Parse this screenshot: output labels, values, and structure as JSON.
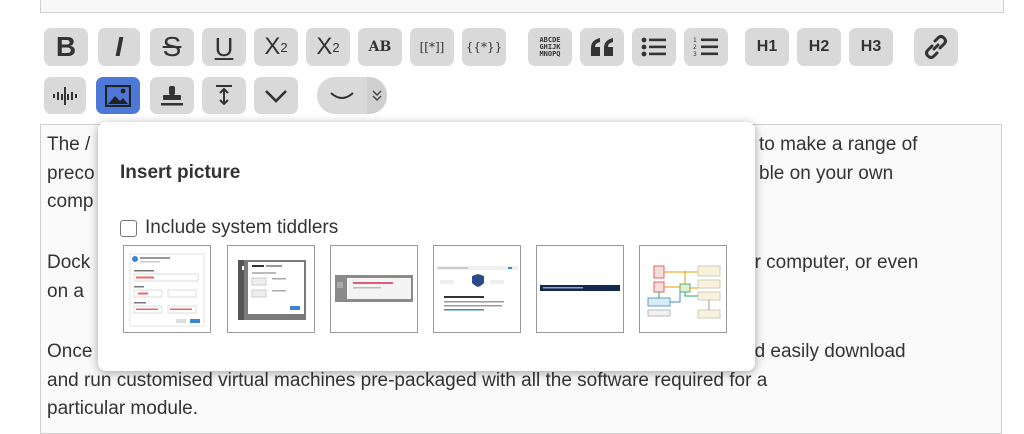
{
  "toolbar": {
    "row1": [
      {
        "name": "bold-button",
        "label": "B"
      },
      {
        "name": "italic-button",
        "label": "I"
      },
      {
        "name": "strikethrough-button",
        "label": "S"
      },
      {
        "name": "underline-button",
        "label": "U"
      },
      {
        "name": "superscript-button",
        "label": "X",
        "sup": "2"
      },
      {
        "name": "subscript-button",
        "label": "X",
        "sub": "2"
      },
      {
        "name": "smallcaps-button",
        "label": "AB"
      },
      {
        "name": "transclude-button",
        "label": "[[*]]"
      },
      {
        "name": "wikitext-button",
        "label": "{{*}}"
      },
      {
        "name": "mono-block-button",
        "lines": [
          "ABCDE",
          "GHIJK",
          "MNOPQ"
        ]
      },
      {
        "name": "quote-button",
        "label": "❝"
      },
      {
        "name": "bullet-list-button",
        "label": "☰"
      },
      {
        "name": "numbered-list-button",
        "label": "☷"
      },
      {
        "name": "heading-1-button",
        "label": "H1"
      },
      {
        "name": "heading-2-button",
        "label": "H2"
      },
      {
        "name": "heading-3-button",
        "label": "H3"
      },
      {
        "name": "link-button",
        "label": "🔗"
      }
    ],
    "row2": [
      {
        "name": "excise-button"
      },
      {
        "name": "picture-button",
        "active": true
      },
      {
        "name": "stamp-button"
      },
      {
        "name": "size-button"
      },
      {
        "name": "more-chevron-button"
      },
      {
        "name": "preview-button"
      }
    ]
  },
  "editor": {
    "paragraphs": [
      {
        "line1": "The /",
        "line1_right": "to make a range of",
        "line2": "preco",
        "line2_right": "ble on your own",
        "line3": "comp"
      },
      {
        "line1": "Dock",
        "line1_right": "ur computer, or even",
        "line2": "on a"
      },
      {
        "line1": "Once",
        "line1_right": "nd easily download",
        "line2": "and run customised virtual machines pre-packaged with all the software required for a",
        "line3": "particular module."
      }
    ]
  },
  "popup": {
    "title": "Insert picture",
    "include_system_label": "Include system tiddlers",
    "include_system_checked": false,
    "thumbnails": [
      "thumbnail-1",
      "thumbnail-2",
      "thumbnail-3",
      "thumbnail-4",
      "thumbnail-5",
      "thumbnail-6"
    ]
  },
  "colors": {
    "active_button": "#4d78d6",
    "button_bg": "#d9d9d9",
    "text": "#333333"
  }
}
